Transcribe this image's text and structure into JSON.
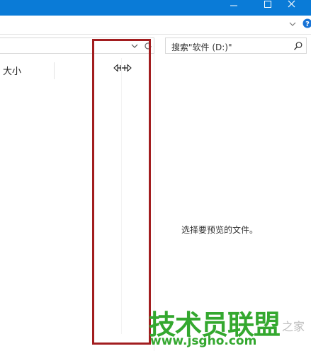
{
  "window": {
    "minimize_icon": "minimize-icon",
    "maximize_icon": "maximize-icon",
    "close_icon": "close-icon",
    "title_bar_color": "#0a7bd7"
  },
  "ribbon": {
    "expand_icon": "chevron-down-icon",
    "help_icon": "help-icon"
  },
  "address_bar": {
    "dropdown_icon": "chevron-down-icon",
    "refresh_icon": "refresh-icon"
  },
  "search": {
    "placeholder": "搜索\"软件 (D:)\"",
    "icon": "search-icon"
  },
  "file_list": {
    "columns": [
      "大小"
    ],
    "resize_cursor_icon": "resize-horizontal-icon"
  },
  "preview_pane": {
    "message": "选择要预览的文件。"
  },
  "annotation": {
    "highlight_color": "#a21d1f"
  },
  "watermark": {
    "title": "技术员联盟",
    "suffix": "之家",
    "url": "www.jsgho.com"
  }
}
